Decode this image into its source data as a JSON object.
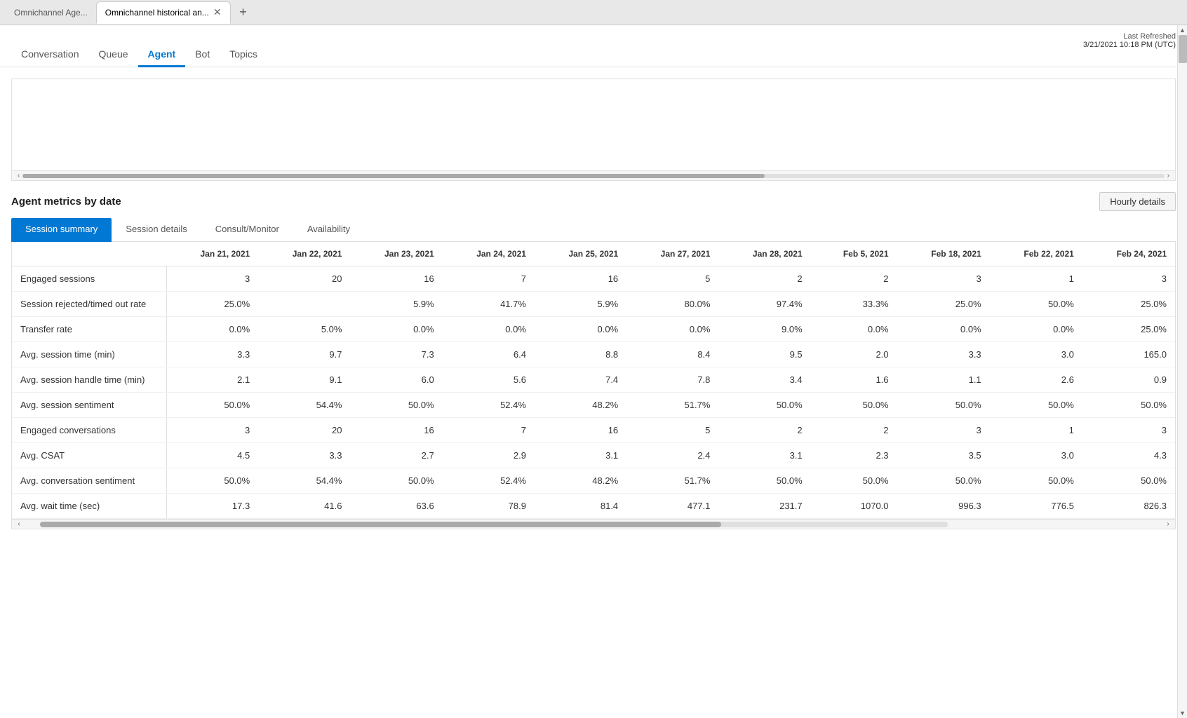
{
  "browser": {
    "tabs": [
      {
        "id": "tab1",
        "label": "Omnichannel Age...",
        "active": false
      },
      {
        "id": "tab2",
        "label": "Omnichannel historical an...",
        "active": true
      }
    ],
    "new_tab_icon": "+"
  },
  "nav": {
    "items": [
      {
        "id": "conversation",
        "label": "Conversation",
        "active": false
      },
      {
        "id": "queue",
        "label": "Queue",
        "active": false
      },
      {
        "id": "agent",
        "label": "Agent",
        "active": true
      },
      {
        "id": "bot",
        "label": "Bot",
        "active": false
      },
      {
        "id": "topics",
        "label": "Topics",
        "active": false
      }
    ],
    "last_refreshed_label": "Last Refreshed",
    "last_refreshed_value": "3/21/2021 10:18 PM (UTC)"
  },
  "metrics": {
    "title": "Agent metrics by date",
    "hourly_details_label": "Hourly details",
    "sub_tabs": [
      {
        "id": "session-summary",
        "label": "Session summary",
        "active": true
      },
      {
        "id": "session-details",
        "label": "Session details",
        "active": false
      },
      {
        "id": "consult-monitor",
        "label": "Consult/Monitor",
        "active": false
      },
      {
        "id": "availability",
        "label": "Availability",
        "active": false
      }
    ],
    "table": {
      "columns": [
        "",
        "Jan 21, 2021",
        "Jan 22, 2021",
        "Jan 23, 2021",
        "Jan 24, 2021",
        "Jan 25, 2021",
        "Jan 27, 2021",
        "Jan 28, 2021",
        "Feb 5, 2021",
        "Feb 18, 2021",
        "Feb 22, 2021",
        "Feb 24, 2021"
      ],
      "rows": [
        {
          "metric": "Engaged sessions",
          "values": [
            "3",
            "20",
            "16",
            "7",
            "16",
            "5",
            "2",
            "2",
            "3",
            "1",
            "3"
          ]
        },
        {
          "metric": "Session rejected/timed out rate",
          "values": [
            "25.0%",
            "",
            "5.9%",
            "41.7%",
            "5.9%",
            "80.0%",
            "97.4%",
            "33.3%",
            "25.0%",
            "50.0%",
            "25.0%"
          ]
        },
        {
          "metric": "Transfer rate",
          "values": [
            "0.0%",
            "5.0%",
            "0.0%",
            "0.0%",
            "0.0%",
            "0.0%",
            "9.0%",
            "0.0%",
            "0.0%",
            "0.0%",
            "25.0%"
          ]
        },
        {
          "metric": "Avg. session time (min)",
          "values": [
            "3.3",
            "9.7",
            "7.3",
            "6.4",
            "8.8",
            "8.4",
            "9.5",
            "2.0",
            "3.3",
            "3.0",
            "165.0"
          ]
        },
        {
          "metric": "Avg. session handle time (min)",
          "values": [
            "2.1",
            "9.1",
            "6.0",
            "5.6",
            "7.4",
            "7.8",
            "3.4",
            "1.6",
            "1.1",
            "2.6",
            "0.9"
          ]
        },
        {
          "metric": "Avg. session sentiment",
          "values": [
            "50.0%",
            "54.4%",
            "50.0%",
            "52.4%",
            "48.2%",
            "51.7%",
            "50.0%",
            "50.0%",
            "50.0%",
            "50.0%",
            "50.0%"
          ]
        },
        {
          "metric": "Engaged conversations",
          "values": [
            "3",
            "20",
            "16",
            "7",
            "16",
            "5",
            "2",
            "2",
            "3",
            "1",
            "3"
          ]
        },
        {
          "metric": "Avg. CSAT",
          "values": [
            "4.5",
            "3.3",
            "2.7",
            "2.9",
            "3.1",
            "2.4",
            "3.1",
            "2.3",
            "3.5",
            "3.0",
            "4.3"
          ]
        },
        {
          "metric": "Avg. conversation sentiment",
          "values": [
            "50.0%",
            "54.4%",
            "50.0%",
            "52.4%",
            "48.2%",
            "51.7%",
            "50.0%",
            "50.0%",
            "50.0%",
            "50.0%",
            "50.0%"
          ]
        },
        {
          "metric": "Avg. wait time (sec)",
          "values": [
            "17.3",
            "41.6",
            "63.6",
            "78.9",
            "81.4",
            "477.1",
            "231.7",
            "1070.0",
            "996.3",
            "776.5",
            "826.3"
          ]
        }
      ]
    }
  }
}
